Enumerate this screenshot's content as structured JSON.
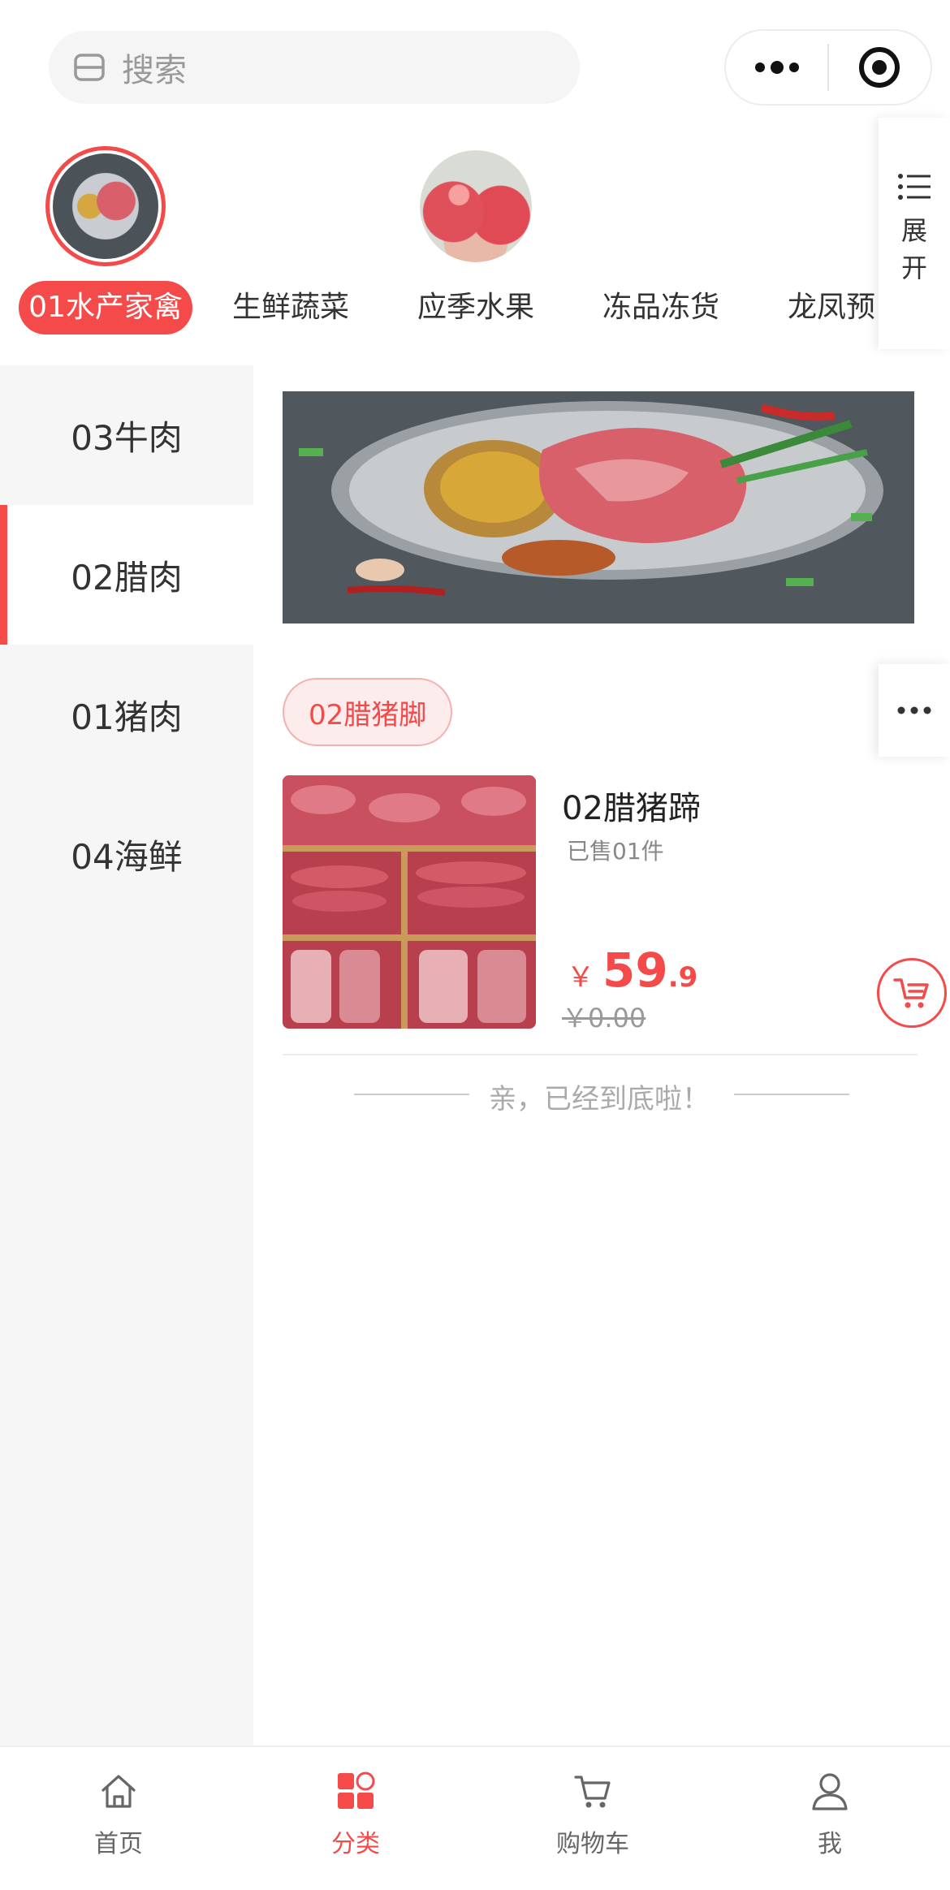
{
  "colors": {
    "accent": "#f44a4a",
    "sidebar_bg": "#f6f6f6",
    "muted": "#999999"
  },
  "search": {
    "placeholder": "搜索",
    "icon": "search-icon"
  },
  "capsule": {
    "more_icon": "more-dots-icon",
    "close_icon": "target-circle-icon"
  },
  "categories": [
    {
      "label": "01水产家禽",
      "active": true,
      "image": "meat-plate"
    },
    {
      "label": "生鲜蔬菜",
      "active": false
    },
    {
      "label": "应季水果",
      "active": false,
      "image": "peaches"
    },
    {
      "label": "冻品冻货",
      "active": false
    },
    {
      "label": "龙凤预",
      "active": false
    }
  ],
  "expand": {
    "label": "展开",
    "chars": [
      "展",
      "开"
    ],
    "icon": "list-icon"
  },
  "sidebar": {
    "items": [
      {
        "label": "03牛肉",
        "active": false
      },
      {
        "label": "02腊肉",
        "active": true
      },
      {
        "label": "01猪肉",
        "active": false
      },
      {
        "label": "04海鲜",
        "active": false
      }
    ]
  },
  "main": {
    "banner_image": "steak-plate",
    "subcategory": "02腊猪脚",
    "products": [
      {
        "name": "02腊猪蹄",
        "sold": "已售01件",
        "currency": "￥",
        "price_int": "59",
        "price_dec": ".9",
        "original_price": "￥0.00"
      }
    ],
    "end_text": "亲，已经到底啦！"
  },
  "tabbar": {
    "tabs": [
      {
        "label": "首页",
        "icon": "home-icon",
        "active": false
      },
      {
        "label": "分类",
        "icon": "category-icon",
        "active": true
      },
      {
        "label": "购物车",
        "icon": "cart-icon",
        "active": false
      },
      {
        "label": "我",
        "icon": "user-icon",
        "active": false
      }
    ]
  }
}
